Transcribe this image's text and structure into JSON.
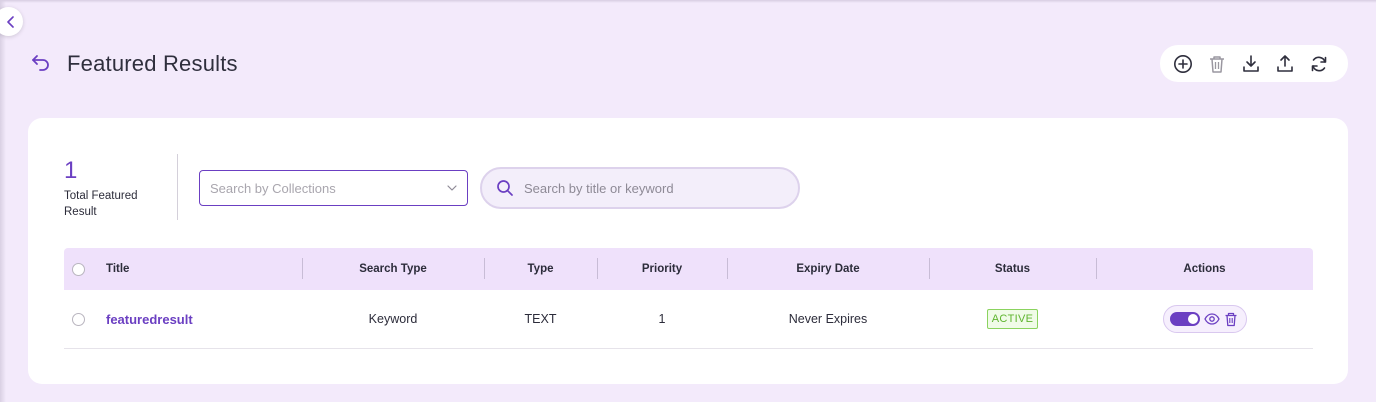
{
  "page": {
    "title": "Featured Results"
  },
  "toolbar": {
    "icons": [
      "add-circle-icon",
      "trash-icon",
      "download-icon",
      "upload-icon",
      "refresh-icon"
    ]
  },
  "stats": {
    "total_count": "1",
    "total_label": "Total Featured Result"
  },
  "filters": {
    "collections_placeholder": "Search by Collections",
    "search_placeholder": "Search by title or keyword",
    "search_value": ""
  },
  "table": {
    "headers": {
      "title": "Title",
      "search_type": "Search Type",
      "type": "Type",
      "priority": "Priority",
      "expiry_date": "Expiry Date",
      "status": "Status",
      "actions": "Actions"
    },
    "rows": [
      {
        "title": "featuredresult",
        "search_type": "Keyword",
        "type": "TEXT",
        "priority": "1",
        "expiry_date": "Never Expires",
        "status": "ACTIVE",
        "enabled": true
      }
    ]
  },
  "colors": {
    "accent": "#6b3fc2",
    "background": "#f3eafb",
    "header_bg": "#efe1fb",
    "status_active": "#5fb52f"
  }
}
